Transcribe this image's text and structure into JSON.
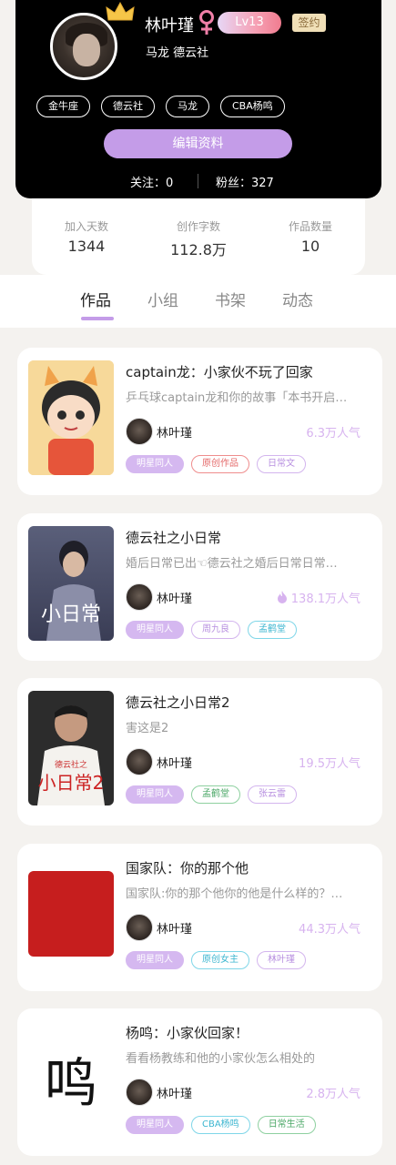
{
  "profile": {
    "name": "林叶瑾",
    "gender_icon": "female-symbol-icon",
    "level": "Lv13",
    "sign_badge": "签约",
    "subtitle": "马龙 德云社",
    "tags": [
      "金牛座",
      "德云社",
      "马龙",
      "CBA杨鸣"
    ],
    "edit_button": "编辑资料",
    "following": "关注：0",
    "fans": "粉丝：327"
  },
  "stats": [
    {
      "label": "加入天数",
      "value": "1344"
    },
    {
      "label": "创作字数",
      "value": "112.8万"
    },
    {
      "label": "作品数量",
      "value": "10"
    }
  ],
  "tabs": [
    "作品",
    "小组",
    "书架",
    "动态"
  ],
  "active_tab": "作品",
  "works": [
    {
      "title": "captain龙：小家伙不玩了回家",
      "desc": "乒乓球captain龙和你的故事「本书开启…",
      "author": "林叶瑾",
      "popularity": "6.3万人气",
      "hot": false,
      "tags": [
        {
          "label": "明星同人",
          "style": "purple"
        },
        {
          "label": "原创作品",
          "style": "red"
        },
        {
          "label": "日常文",
          "style": "lilac"
        }
      ]
    },
    {
      "title": "德云社之小日常",
      "desc": "婚后日常已出☜德云社之婚后日常日常…",
      "author": "林叶瑾",
      "popularity": "138.1万人气",
      "hot": true,
      "tags": [
        {
          "label": "明星同人",
          "style": "purple"
        },
        {
          "label": "周九良",
          "style": "lilac"
        },
        {
          "label": "孟鹤堂",
          "style": "cyan"
        }
      ],
      "cover_text": "小日常"
    },
    {
      "title": "德云社之小日常2",
      "desc": "害这是2",
      "author": "林叶瑾",
      "popularity": "19.5万人气",
      "hot": false,
      "tags": [
        {
          "label": "明星同人",
          "style": "purple"
        },
        {
          "label": "孟鹤堂",
          "style": "green"
        },
        {
          "label": "张云雷",
          "style": "lilac"
        }
      ],
      "cover_text": "小日常2",
      "cover_sub": "德云社之"
    },
    {
      "title": "国家队：你的那个他",
      "desc": "国家队:你的那个他你的他是什么样的？…",
      "author": "林叶瑾",
      "popularity": "44.3万人气",
      "hot": false,
      "tags": [
        {
          "label": "明星同人",
          "style": "purple"
        },
        {
          "label": "原创女主",
          "style": "cyan"
        },
        {
          "label": "林叶瑾",
          "style": "lilac"
        }
      ]
    },
    {
      "title": "杨鸣：小家伙回家！",
      "desc": "看看杨教练和他的小家伙怎么相处的",
      "author": "林叶瑾",
      "popularity": "2.8万人气",
      "hot": false,
      "tags": [
        {
          "label": "明星同人",
          "style": "purple"
        },
        {
          "label": "CBA杨鸣",
          "style": "cyan"
        },
        {
          "label": "日常生活",
          "style": "green"
        }
      ],
      "cover_text": "鸣"
    }
  ],
  "colors": {
    "accent": "#c49ce8",
    "popularity": "#d7b3ef",
    "header_bg": "#000000"
  }
}
